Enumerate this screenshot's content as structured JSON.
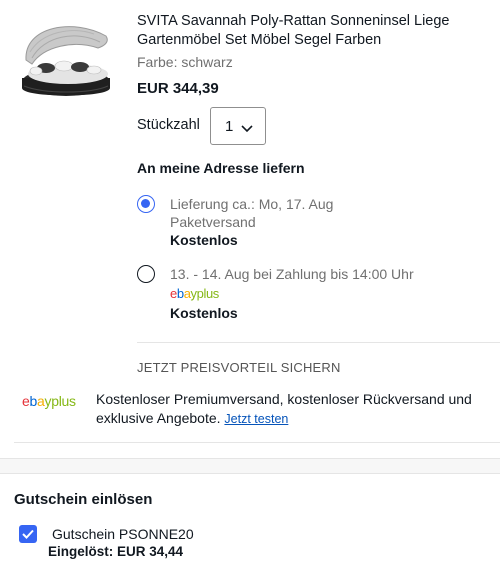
{
  "product": {
    "image_icon": "rattan-sun-island-image",
    "title": "SVITA Savannah Poly-Rattan Sonneninsel Liege Gartenmöbel Set Möbel Segel Farben",
    "variant": "Farbe: schwarz",
    "price": "EUR 344,39"
  },
  "quantity": {
    "label": "Stückzahl",
    "value": "1",
    "icon": "chevron-down-icon"
  },
  "shipping": {
    "heading": "An meine Adresse liefern",
    "options": [
      {
        "selected": true,
        "line1": "Lieferung ca.: Mo, 17. Aug",
        "line2": "Paketversand",
        "cost": "Kostenlos"
      },
      {
        "selected": false,
        "line1": "13. - 14. Aug bei Zahlung bis 14:00 Uhr",
        "badge": {
          "e": "e",
          "b": "b",
          "a": "a",
          "y": "y",
          "plus": "plus"
        },
        "cost": "Kostenlos"
      }
    ]
  },
  "promo": {
    "heading": "JETZT PREISVORTEIL SICHERN",
    "logo": {
      "e": "e",
      "b": "b",
      "a": "a",
      "y": "y",
      "plus": "plus"
    },
    "text": "Kostenloser Premiumversand, kostenloser Rückversand und exklusive Angebote.",
    "link": "Jetzt testen"
  },
  "coupon": {
    "heading": "Gutschein einlösen",
    "checked": true,
    "name": "Gutschein PSONNE20",
    "redeemed": "Eingelöst: EUR 34,44"
  },
  "colors": {
    "accent_blue": "#3665f3",
    "link_blue": "#0654ba",
    "ebay_red": "#e53238",
    "ebay_blue": "#0064d2",
    "ebay_yellow": "#f5af02",
    "ebay_green": "#86b817"
  }
}
